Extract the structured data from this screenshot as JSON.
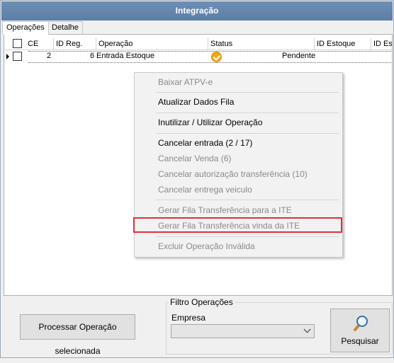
{
  "window": {
    "title": "Integração"
  },
  "tabs": [
    {
      "label": "Operações",
      "active": true
    },
    {
      "label": "Detalhe",
      "active": false
    }
  ],
  "grid": {
    "columns": [
      "CE",
      "ID Reg.",
      "Operação",
      "Status",
      "ID Estoque",
      "ID Es"
    ],
    "rows": [
      {
        "ce_checked": false,
        "id_reg": "2",
        "operacao_num": "6",
        "operacao": "Entrada Estoque",
        "status_icon": "check-circle-icon",
        "status_text": "Pendente"
      }
    ]
  },
  "context_menu": {
    "items": [
      {
        "label": "Baixar ATPV-e",
        "enabled": false
      },
      {
        "label": "Atualizar Dados Fila",
        "enabled": true
      },
      {
        "label": "Inutilizar / Utilizar Operação",
        "enabled": true
      },
      {
        "label": "Cancelar entrada (2 / 17)",
        "enabled": true
      },
      {
        "label": "Cancelar Venda (6)",
        "enabled": false
      },
      {
        "label": "Cancelar autorização transferência (10)",
        "enabled": false
      },
      {
        "label": "Cancelar entrega veiculo",
        "enabled": false
      },
      {
        "label": "Gerar Fila Transferência para a ITE",
        "enabled": false
      },
      {
        "label": "Gerar Fila Transferência vinda da ITE",
        "enabled": false,
        "highlighted": true
      },
      {
        "label": "Excluir Operação Inválida",
        "enabled": false
      }
    ],
    "highlight_color": "#e0303a"
  },
  "footer": {
    "process_button": "Processar Operação selecionada",
    "filter_group": "Filtro Operações",
    "empresa_label": "Empresa",
    "empresa_value": "",
    "search_button": "Pesquisar"
  },
  "colors": {
    "titlebar": "#5b7ea8",
    "status_icon": "#f0a818"
  }
}
